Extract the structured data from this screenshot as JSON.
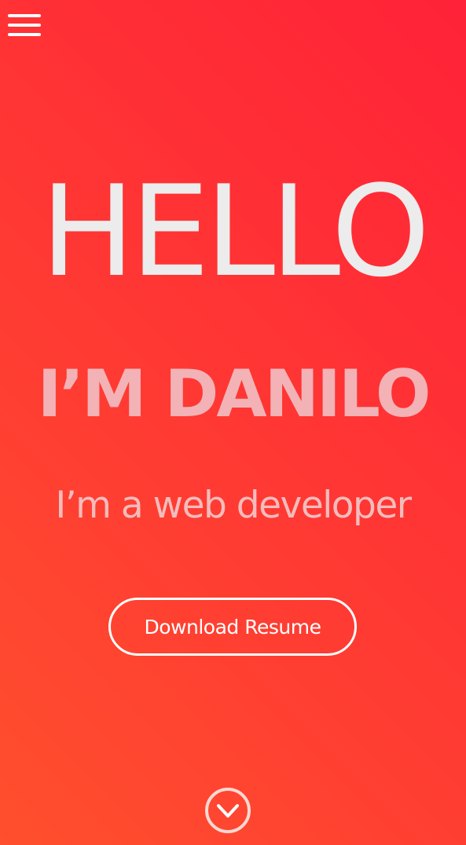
{
  "nav": {
    "menu_icon": "hamburger-menu-icon"
  },
  "hero": {
    "greeting": "HELLO",
    "name_line": "I’M DANILO",
    "tagline": "I’m a web developer"
  },
  "cta": {
    "download_label": "Download Resume"
  },
  "scroll": {
    "icon": "chevron-down-icon"
  },
  "colors": {
    "gradient_start": "#ff4f2d",
    "gradient_end": "#ff2238",
    "heading": "#ececec",
    "name": "#f2b2b6",
    "tagline": "#f3bcbc",
    "button_border": "#ffffff",
    "scroll_icon": "#ffd8d2"
  }
}
